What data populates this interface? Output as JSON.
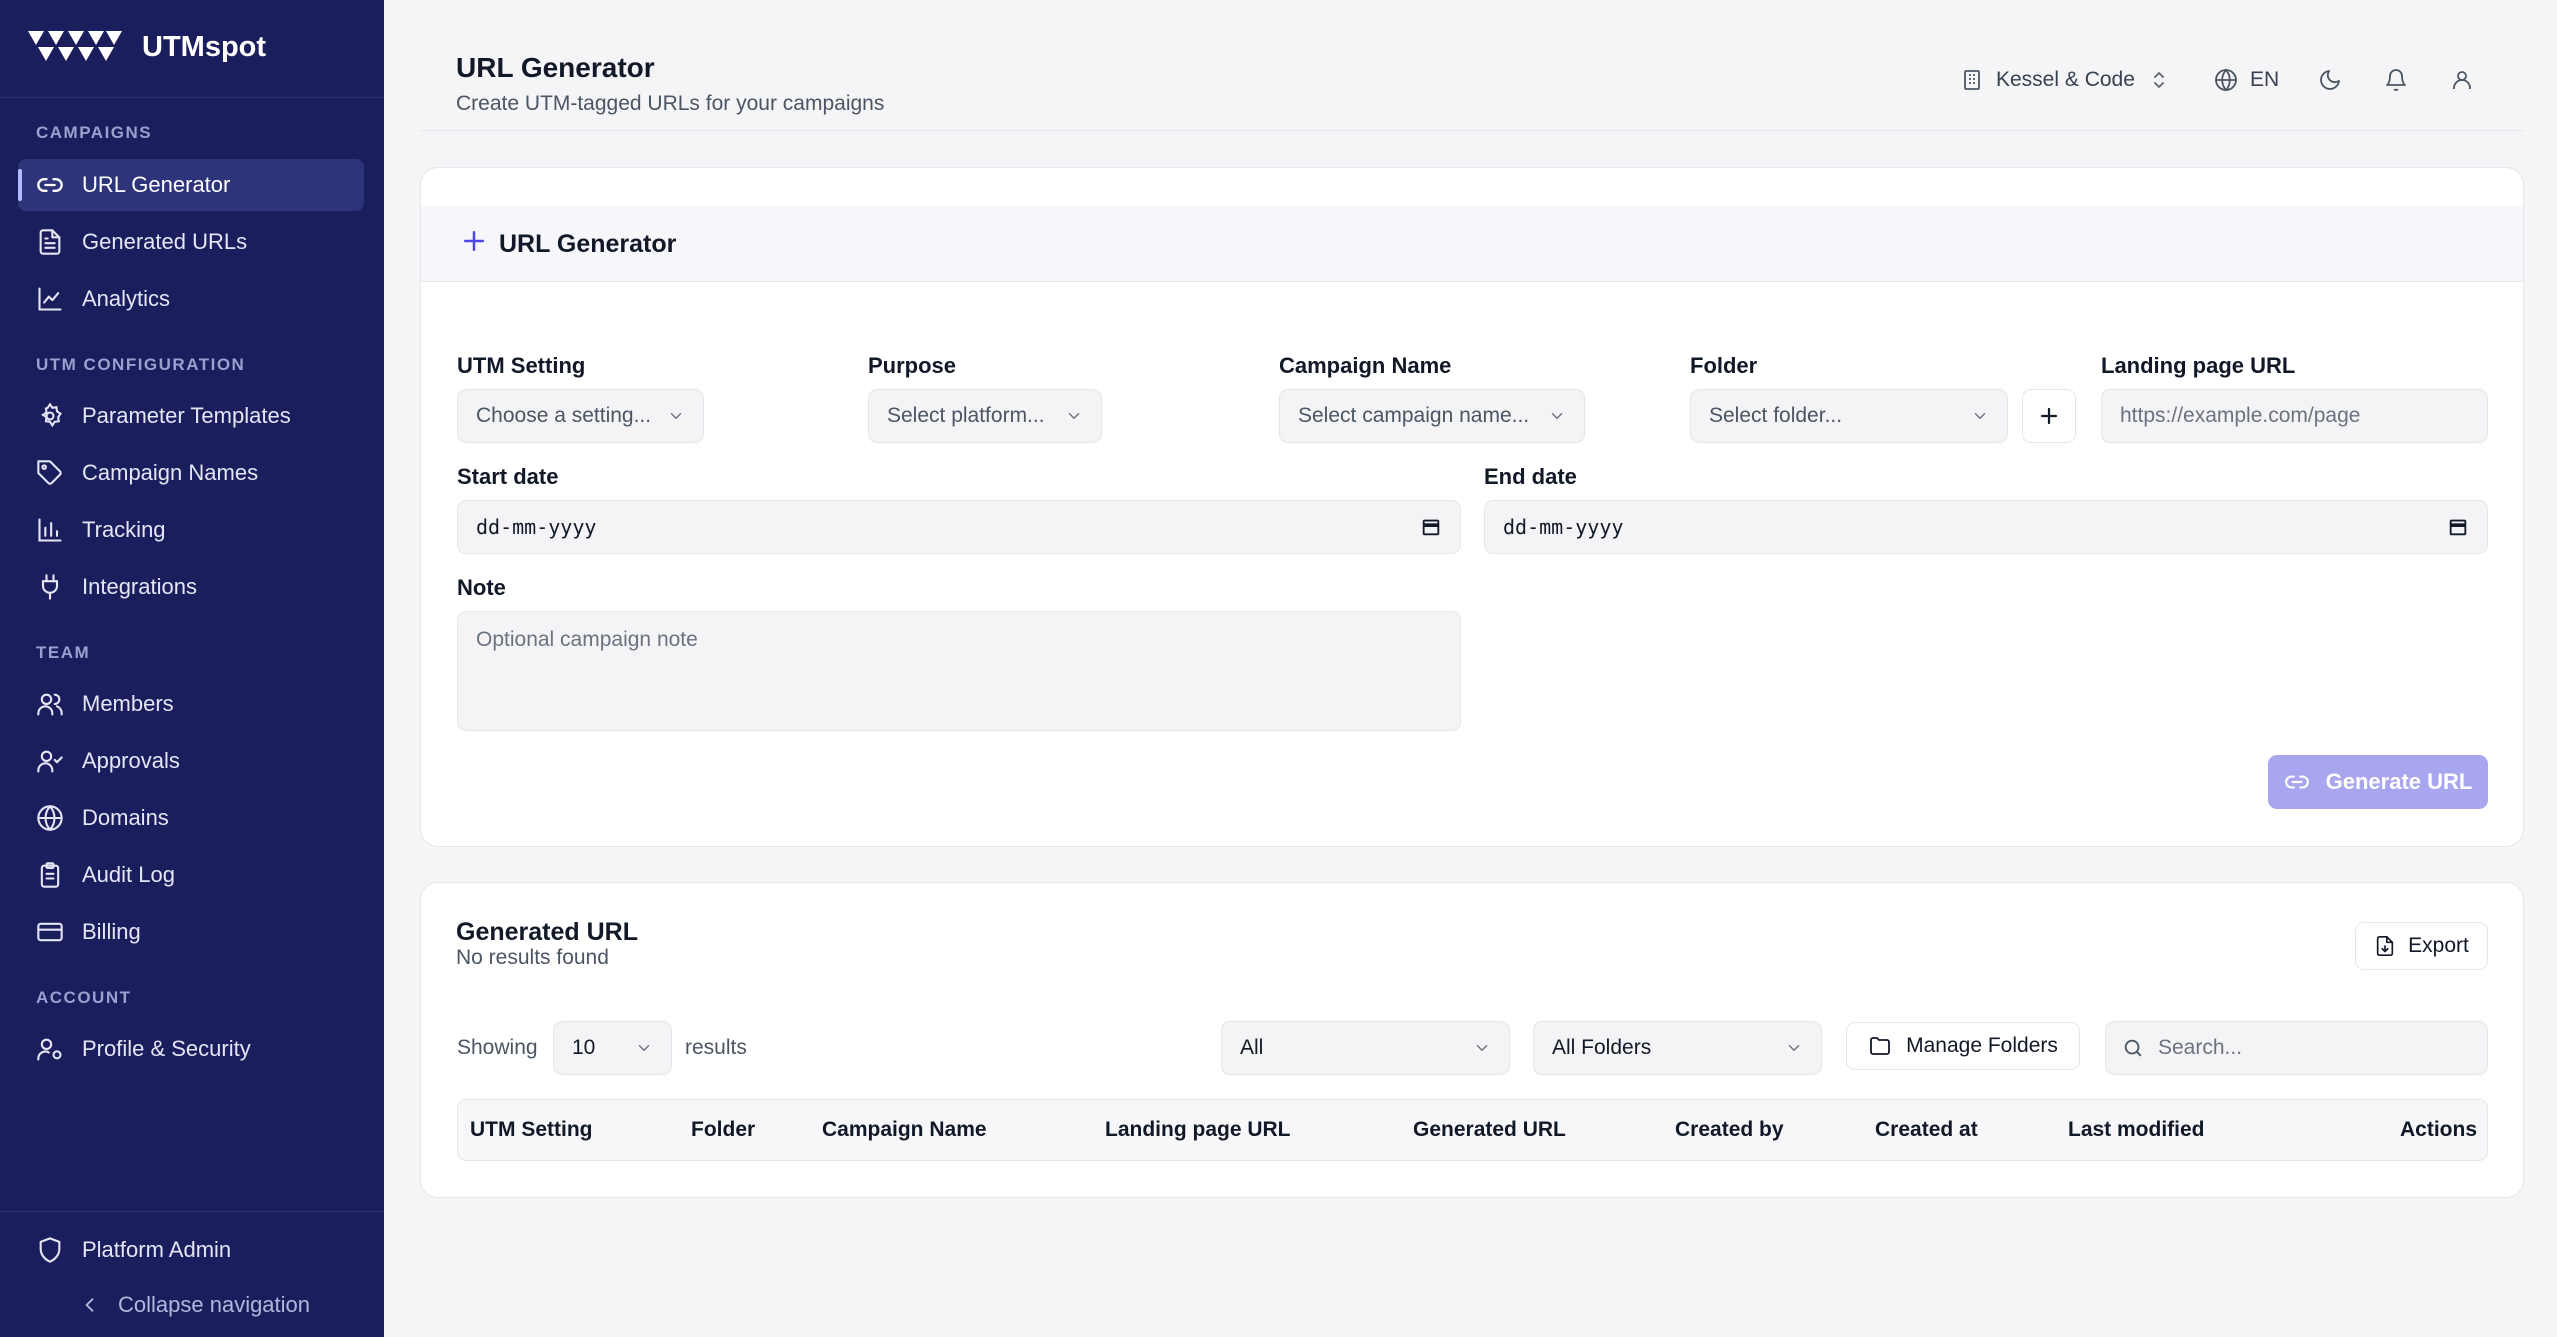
{
  "app": {
    "name": "UTMspot"
  },
  "sidebar": {
    "sections": [
      {
        "label": "CAMPAIGNS"
      },
      {
        "label": "UTM CONFIGURATION"
      },
      {
        "label": "TEAM"
      },
      {
        "label": "ACCOUNT"
      }
    ],
    "items": [
      {
        "label": "URL Generator",
        "icon": "link-icon",
        "active": true
      },
      {
        "label": "Generated URLs",
        "icon": "file-text-icon"
      },
      {
        "label": "Analytics",
        "icon": "line-chart-icon"
      },
      {
        "label": "Parameter Templates",
        "icon": "gear-icon"
      },
      {
        "label": "Campaign Names",
        "icon": "tag-icon"
      },
      {
        "label": "Tracking",
        "icon": "bar-chart-icon"
      },
      {
        "label": "Integrations",
        "icon": "plug-icon"
      },
      {
        "label": "Members",
        "icon": "users-icon"
      },
      {
        "label": "Approvals",
        "icon": "user-check-icon"
      },
      {
        "label": "Domains",
        "icon": "globe-icon"
      },
      {
        "label": "Audit Log",
        "icon": "clipboard-icon"
      },
      {
        "label": "Billing",
        "icon": "credit-card-icon"
      },
      {
        "label": "Profile & Security",
        "icon": "user-gear-icon"
      }
    ],
    "platform_admin": "Platform Admin",
    "collapse": "Collapse navigation"
  },
  "header": {
    "title": "URL Generator",
    "subtitle": "Create UTM-tagged URLs for your campaigns",
    "workspace": "Kessel & Code",
    "language": "EN"
  },
  "generator": {
    "title": "URL Generator",
    "fields": {
      "utm_setting": {
        "label": "UTM Setting",
        "placeholder": "Choose a setting..."
      },
      "purpose": {
        "label": "Purpose",
        "placeholder": "Select platform..."
      },
      "campaign_name": {
        "label": "Campaign Name",
        "placeholder": "Select campaign name..."
      },
      "folder": {
        "label": "Folder",
        "placeholder": "Select folder..."
      },
      "landing_url": {
        "label": "Landing page URL",
        "placeholder": "https://example.com/page"
      },
      "start_date": {
        "label": "Start date",
        "value": "dd-mm-yyyy"
      },
      "end_date": {
        "label": "End date",
        "value": "dd-mm-yyyy"
      },
      "note": {
        "label": "Note",
        "placeholder": "Optional campaign note"
      }
    },
    "generate_button": "Generate URL"
  },
  "results": {
    "title": "Generated URL",
    "subtitle": "No results found",
    "export_button": "Export",
    "showing_label": "Showing",
    "page_size": "10",
    "results_label": "results",
    "filter_status": "All",
    "filter_folder": "All Folders",
    "manage_folders": "Manage Folders",
    "search_placeholder": "Search...",
    "columns": [
      "UTM Setting",
      "Folder",
      "Campaign Name",
      "Landing page URL",
      "Generated URL",
      "Created by",
      "Created at",
      "Last modified",
      "Actions"
    ]
  },
  "colors": {
    "sidebar_bg": "#1b1e5c",
    "accent": "#a9a6f0",
    "page_bg": "#f5f5f7"
  }
}
